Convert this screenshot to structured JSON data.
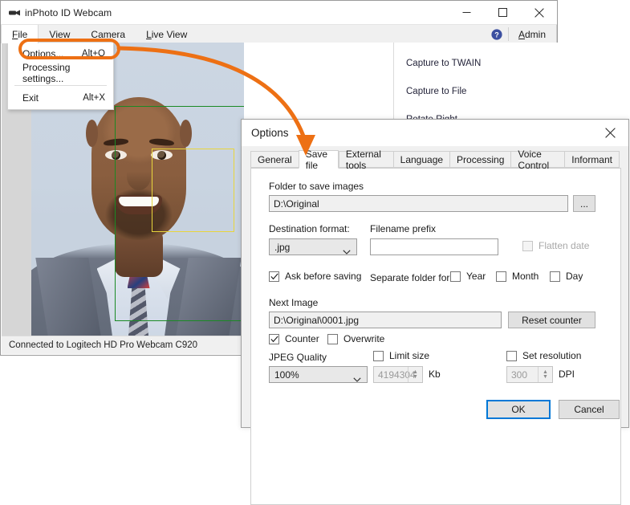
{
  "app": {
    "title": "inPhoto ID Webcam",
    "icon": "webcam-icon",
    "window_controls": {
      "minimize": "minimize-icon",
      "maximize": "maximize-icon",
      "close": "close-icon"
    },
    "menu": [
      {
        "label": "File",
        "accel": "F",
        "open": true
      },
      {
        "label": "View",
        "accel": "V",
        "open": false
      },
      {
        "label": "Camera",
        "accel": "C",
        "open": false
      },
      {
        "label": "Live View",
        "accel": "L",
        "open": false
      }
    ],
    "menu_right": {
      "help_icon": "help-circle-icon",
      "admin_label": "Admin",
      "admin_accel": "A"
    },
    "file_dropdown": [
      {
        "label": "Options...",
        "accel": "Alt+O",
        "highlighted": true
      },
      {
        "label": "Processing settings...",
        "accel": ""
      },
      {
        "label": "Exit",
        "accel": "Alt+X"
      }
    ],
    "command_panel": [
      "Capture to TWAIN",
      "Capture to File",
      "Rotate Right"
    ],
    "status_bar": "Connected to Logitech HD Pro Webcam C920",
    "preview": {
      "crop_frame_color": "#1a8a24",
      "face_frame_color": "#e8d53c"
    }
  },
  "dialog": {
    "title": "Options",
    "close_icon": "close-icon",
    "tabs": [
      {
        "label": "General",
        "active": false
      },
      {
        "label": "Save file",
        "active": true
      },
      {
        "label": "External tools",
        "active": false
      },
      {
        "label": "Language",
        "active": false
      },
      {
        "label": "Processing",
        "active": false
      },
      {
        "label": "Voice Control",
        "active": false
      },
      {
        "label": "Informant",
        "active": false
      }
    ],
    "save_file": {
      "folder_label": "Folder to save images",
      "folder_value": "D:\\Original",
      "browse_label": "...",
      "destination_format_label": "Destination format:",
      "destination_format_value": ".jpg",
      "filename_prefix_label": "Filename prefix",
      "filename_prefix_value": "",
      "flatten_date_label": "Flatten date",
      "flatten_date_checked": false,
      "flatten_date_enabled": false,
      "ask_before_saving_label": "Ask before saving",
      "ask_before_saving_checked": true,
      "separate_folder_label": "Separate folder for",
      "separate_year_label": "Year",
      "separate_year_checked": false,
      "separate_month_label": "Month",
      "separate_month_checked": false,
      "separate_day_label": "Day",
      "separate_day_checked": false,
      "next_image_label": "Next Image",
      "next_image_value": "D:\\Original\\0001.jpg",
      "reset_counter_label": "Reset counter",
      "counter_label": "Counter",
      "counter_checked": true,
      "overwrite_label": "Overwrite",
      "overwrite_checked": false,
      "jpeg_quality_label": "JPEG Quality",
      "jpeg_quality_value": "100%",
      "limit_size_label": "Limit size",
      "limit_size_checked": false,
      "limit_size_value": "4194304",
      "limit_size_unit": "Kb",
      "set_resolution_label": "Set resolution",
      "set_resolution_checked": false,
      "set_resolution_value": "300",
      "set_resolution_unit": "DPI"
    },
    "buttons": {
      "ok_label": "OK",
      "cancel_label": "Cancel"
    }
  },
  "annotation": {
    "color": "#ED7014",
    "highlight_target": "Options...",
    "arrow_target": "Save file"
  }
}
